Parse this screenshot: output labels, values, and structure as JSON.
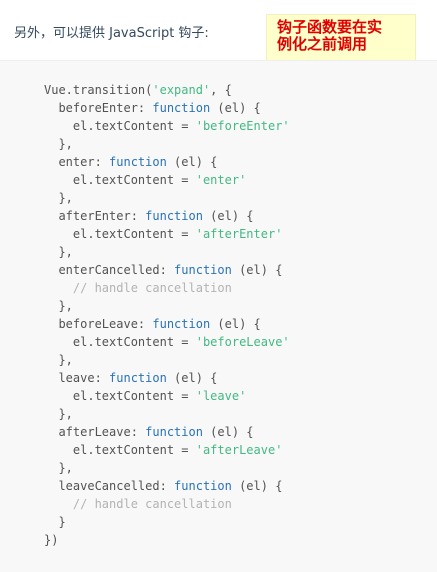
{
  "intro_text": "另外，可以提供 JavaScript 钩子:",
  "note": {
    "line1": "钩子函数要在实",
    "line2": "例化之前调用"
  },
  "code_lines": [
    {
      "indent": "",
      "tokens": [
        {
          "t": "Vue.transition(",
          "c": "pl"
        },
        {
          "t": "'expand'",
          "c": "str"
        },
        {
          "t": ", {",
          "c": "pl"
        }
      ]
    },
    {
      "indent": "  ",
      "tokens": [
        {
          "t": "beforeEnter: ",
          "c": "pl"
        },
        {
          "t": "function",
          "c": "kw"
        },
        {
          "t": " (el) {",
          "c": "pl"
        }
      ]
    },
    {
      "indent": "    ",
      "tokens": [
        {
          "t": "el.textContent = ",
          "c": "pl"
        },
        {
          "t": "'beforeEnter'",
          "c": "str"
        }
      ]
    },
    {
      "indent": "  ",
      "tokens": [
        {
          "t": "},",
          "c": "pl"
        }
      ]
    },
    {
      "indent": "  ",
      "tokens": [
        {
          "t": "enter: ",
          "c": "pl"
        },
        {
          "t": "function",
          "c": "kw"
        },
        {
          "t": " (el) {",
          "c": "pl"
        }
      ]
    },
    {
      "indent": "    ",
      "tokens": [
        {
          "t": "el.textContent = ",
          "c": "pl"
        },
        {
          "t": "'enter'",
          "c": "str"
        }
      ]
    },
    {
      "indent": "  ",
      "tokens": [
        {
          "t": "},",
          "c": "pl"
        }
      ]
    },
    {
      "indent": "  ",
      "tokens": [
        {
          "t": "afterEnter: ",
          "c": "pl"
        },
        {
          "t": "function",
          "c": "kw"
        },
        {
          "t": " (el) {",
          "c": "pl"
        }
      ]
    },
    {
      "indent": "    ",
      "tokens": [
        {
          "t": "el.textContent = ",
          "c": "pl"
        },
        {
          "t": "'afterEnter'",
          "c": "str"
        }
      ]
    },
    {
      "indent": "  ",
      "tokens": [
        {
          "t": "},",
          "c": "pl"
        }
      ]
    },
    {
      "indent": "  ",
      "tokens": [
        {
          "t": "enterCancelled: ",
          "c": "pl"
        },
        {
          "t": "function",
          "c": "kw"
        },
        {
          "t": " (el) {",
          "c": "pl"
        }
      ]
    },
    {
      "indent": "    ",
      "tokens": [
        {
          "t": "// handle cancellation",
          "c": "cm"
        }
      ]
    },
    {
      "indent": "  ",
      "tokens": [
        {
          "t": "},",
          "c": "pl"
        }
      ]
    },
    {
      "indent": "  ",
      "tokens": [
        {
          "t": "beforeLeave: ",
          "c": "pl"
        },
        {
          "t": "function",
          "c": "kw"
        },
        {
          "t": " (el) {",
          "c": "pl"
        }
      ]
    },
    {
      "indent": "    ",
      "tokens": [
        {
          "t": "el.textContent = ",
          "c": "pl"
        },
        {
          "t": "'beforeLeave'",
          "c": "str"
        }
      ]
    },
    {
      "indent": "  ",
      "tokens": [
        {
          "t": "},",
          "c": "pl"
        }
      ]
    },
    {
      "indent": "  ",
      "tokens": [
        {
          "t": "leave: ",
          "c": "pl"
        },
        {
          "t": "function",
          "c": "kw"
        },
        {
          "t": " (el) {",
          "c": "pl"
        }
      ]
    },
    {
      "indent": "    ",
      "tokens": [
        {
          "t": "el.textContent = ",
          "c": "pl"
        },
        {
          "t": "'leave'",
          "c": "str"
        }
      ]
    },
    {
      "indent": "  ",
      "tokens": [
        {
          "t": "},",
          "c": "pl"
        }
      ]
    },
    {
      "indent": "  ",
      "tokens": [
        {
          "t": "afterLeave: ",
          "c": "pl"
        },
        {
          "t": "function",
          "c": "kw"
        },
        {
          "t": " (el) {",
          "c": "pl"
        }
      ]
    },
    {
      "indent": "    ",
      "tokens": [
        {
          "t": "el.textContent = ",
          "c": "pl"
        },
        {
          "t": "'afterLeave'",
          "c": "str"
        }
      ]
    },
    {
      "indent": "  ",
      "tokens": [
        {
          "t": "},",
          "c": "pl"
        }
      ]
    },
    {
      "indent": "  ",
      "tokens": [
        {
          "t": "leaveCancelled: ",
          "c": "pl"
        },
        {
          "t": "function",
          "c": "kw"
        },
        {
          "t": " (el) {",
          "c": "pl"
        }
      ]
    },
    {
      "indent": "    ",
      "tokens": [
        {
          "t": "// handle cancellation",
          "c": "cm"
        }
      ]
    },
    {
      "indent": "  ",
      "tokens": [
        {
          "t": "}",
          "c": "pl"
        }
      ]
    },
    {
      "indent": "",
      "tokens": [
        {
          "t": "})",
          "c": "pl"
        }
      ]
    }
  ],
  "colors": {
    "string": "#42b983",
    "keyword": "#2973b7",
    "comment": "#b3b3b3",
    "plain": "#525252",
    "note_text": "#e00000",
    "note_bg": "#ffffcc",
    "code_bg": "#f8f8f8"
  }
}
